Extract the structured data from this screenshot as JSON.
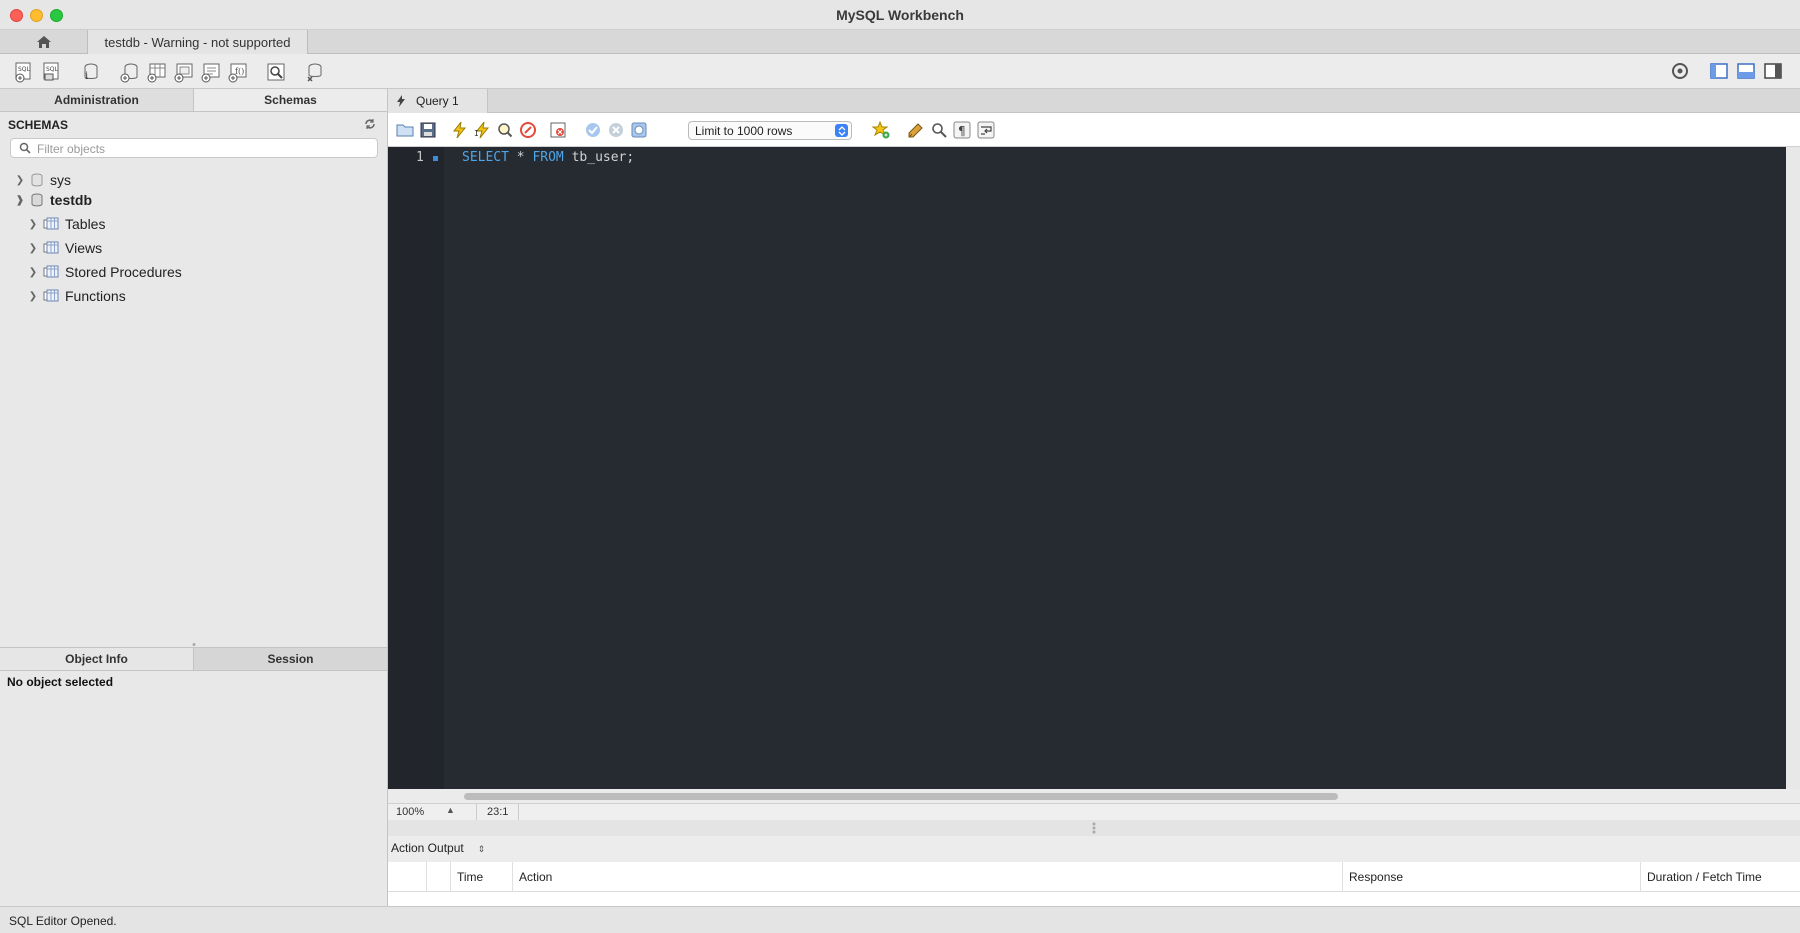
{
  "window": {
    "title": "MySQL Workbench"
  },
  "tabs": {
    "connection_tab": "testdb - Warning - not supported"
  },
  "sidebar": {
    "tabs": [
      "Administration",
      "Schemas"
    ],
    "active_tab": "Schemas",
    "header": "SCHEMAS",
    "filter_placeholder": "Filter objects",
    "tree": [
      {
        "label": "sys",
        "level": 0,
        "expanded": false,
        "icon": "database-icon"
      },
      {
        "label": "testdb",
        "level": 0,
        "expanded": true,
        "icon": "database-icon",
        "bold": true
      },
      {
        "label": "Tables",
        "level": 1,
        "expanded": false,
        "icon": "folder-table-icon"
      },
      {
        "label": "Views",
        "level": 1,
        "expanded": false,
        "icon": "folder-table-icon"
      },
      {
        "label": "Stored Procedures",
        "level": 1,
        "expanded": false,
        "icon": "folder-table-icon"
      },
      {
        "label": "Functions",
        "level": 1,
        "expanded": false,
        "icon": "folder-table-icon"
      }
    ],
    "info_tabs": [
      "Object Info",
      "Session"
    ],
    "active_info_tab": "Object Info",
    "info_text": "No object selected"
  },
  "editor": {
    "query_tab": "Query 1",
    "limit_select": "Limit to 1000 rows",
    "line_number": "1",
    "code_keyword1": "SELECT",
    "code_middle": " * ",
    "code_keyword2": "FROM",
    "code_rest": " tb_user;",
    "zoom": "100%",
    "cursor_position": "23:1"
  },
  "output": {
    "selector": "Action Output",
    "columns": [
      "Time",
      "Action",
      "Response",
      "Duration / Fetch Time"
    ]
  },
  "status": {
    "message": "SQL Editor Opened."
  },
  "colors": {
    "editor_bg": "#262a31",
    "keyword": "#4ea6e8",
    "accent": "#3b82f6"
  }
}
